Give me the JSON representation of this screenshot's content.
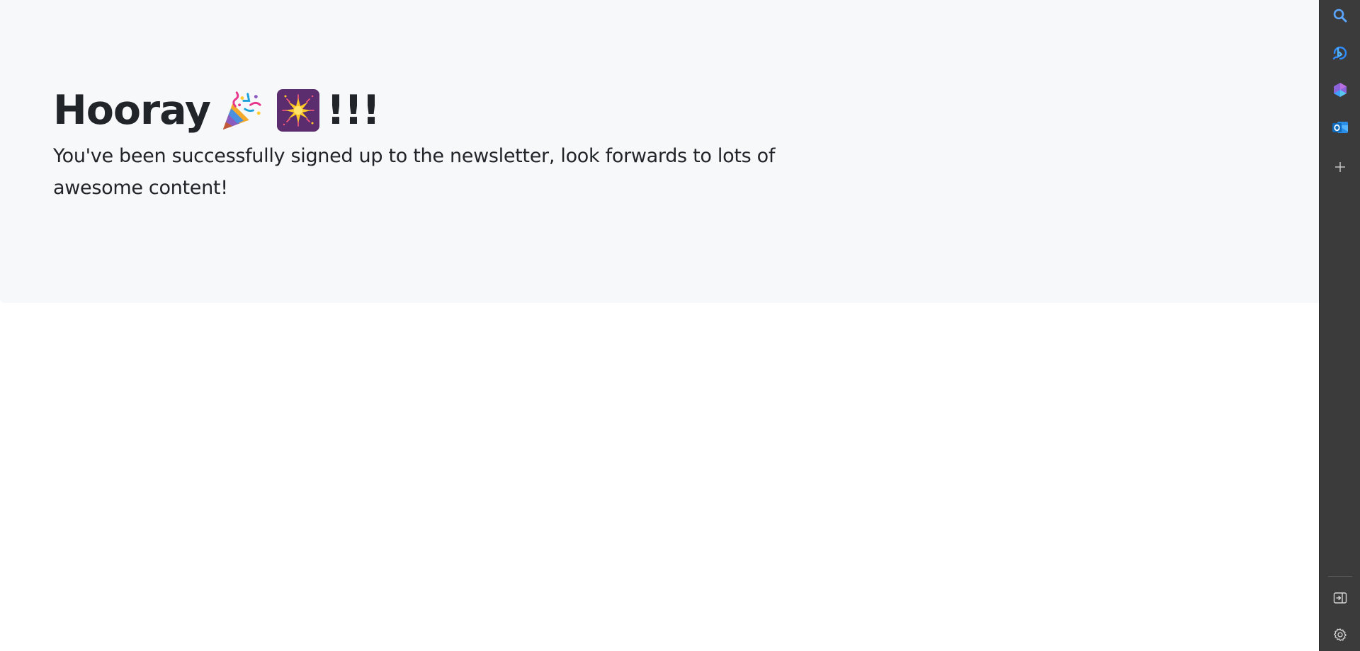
{
  "hero": {
    "title_word": "Hooray",
    "title_emoji_1": "party-popper-icon",
    "title_emoji_2": "fireworks-sparkler-icon",
    "title_suffix": "!!!",
    "lead": "You've been successfully signed up to the newsletter, look forwards to lots of awesome content!"
  },
  "sidebar": {
    "items": [
      {
        "name": "search-icon",
        "label": "Search"
      },
      {
        "name": "bing-icon",
        "label": "Bing"
      },
      {
        "name": "office-icon",
        "label": "Microsoft 365"
      },
      {
        "name": "outlook-icon",
        "label": "Outlook"
      },
      {
        "name": "add-icon",
        "label": "Add"
      }
    ],
    "bottom": [
      {
        "name": "hide-sidebar-icon",
        "label": "Hide sidebar"
      },
      {
        "name": "settings-gear-icon",
        "label": "Settings"
      }
    ]
  },
  "colors": {
    "hero_bg": "#f7f8fa",
    "text": "#212529",
    "sidebar_bg": "#3b3b3b",
    "accent_blue": "#4aa0ff"
  }
}
